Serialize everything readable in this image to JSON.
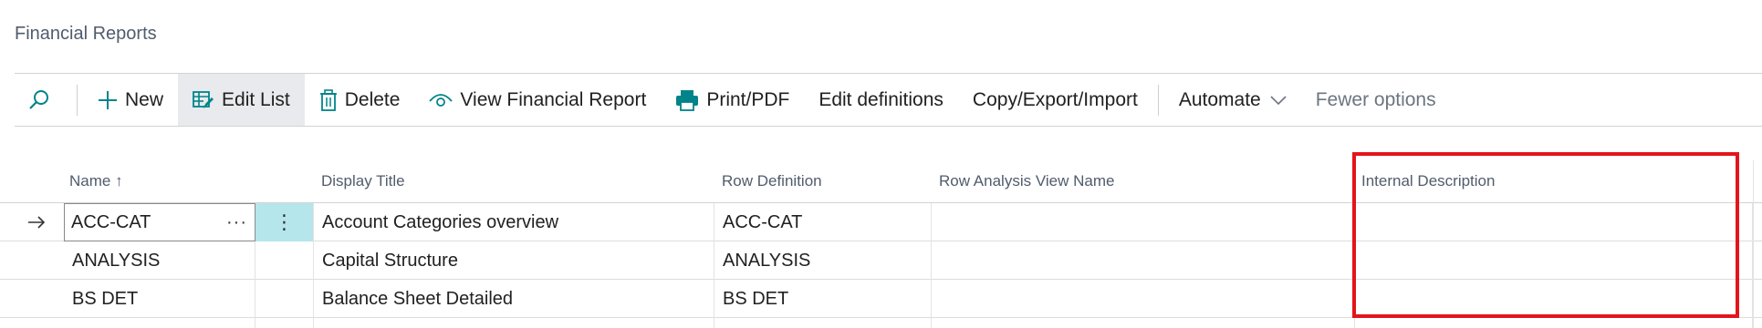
{
  "page": {
    "title": "Financial Reports"
  },
  "actions": {
    "search_icon": "search-icon",
    "new": "New",
    "edit_list": "Edit List",
    "delete": "Delete",
    "view_report": "View Financial Report",
    "print_pdf": "Print/PDF",
    "edit_definitions": "Edit definitions",
    "copy_export_import": "Copy/Export/Import",
    "automate": "Automate",
    "fewer_options": "Fewer options"
  },
  "columns": {
    "name": "Name",
    "name_sort_indicator": "↑",
    "display_title": "Display Title",
    "row_definition": "Row Definition",
    "row_analysis_view_name": "Row Analysis View Name",
    "internal_description": "Internal Description"
  },
  "rows": [
    {
      "name": "ACC-CAT",
      "display_title": "Account Categories overview",
      "row_definition": "ACC-CAT",
      "row_analysis_view_name": "",
      "internal_description": ""
    },
    {
      "name": "ANALYSIS",
      "display_title": "Capital Structure",
      "row_definition": "ANALYSIS",
      "row_analysis_view_name": "",
      "internal_description": ""
    },
    {
      "name": "BS DET",
      "display_title": "Balance Sheet Detailed",
      "row_definition": "BS DET",
      "row_analysis_view_name": "",
      "internal_description": ""
    }
  ],
  "colors": {
    "accent": "#008489",
    "selected_cell": "#b5e6ec",
    "highlight_box": "#e3141c"
  }
}
